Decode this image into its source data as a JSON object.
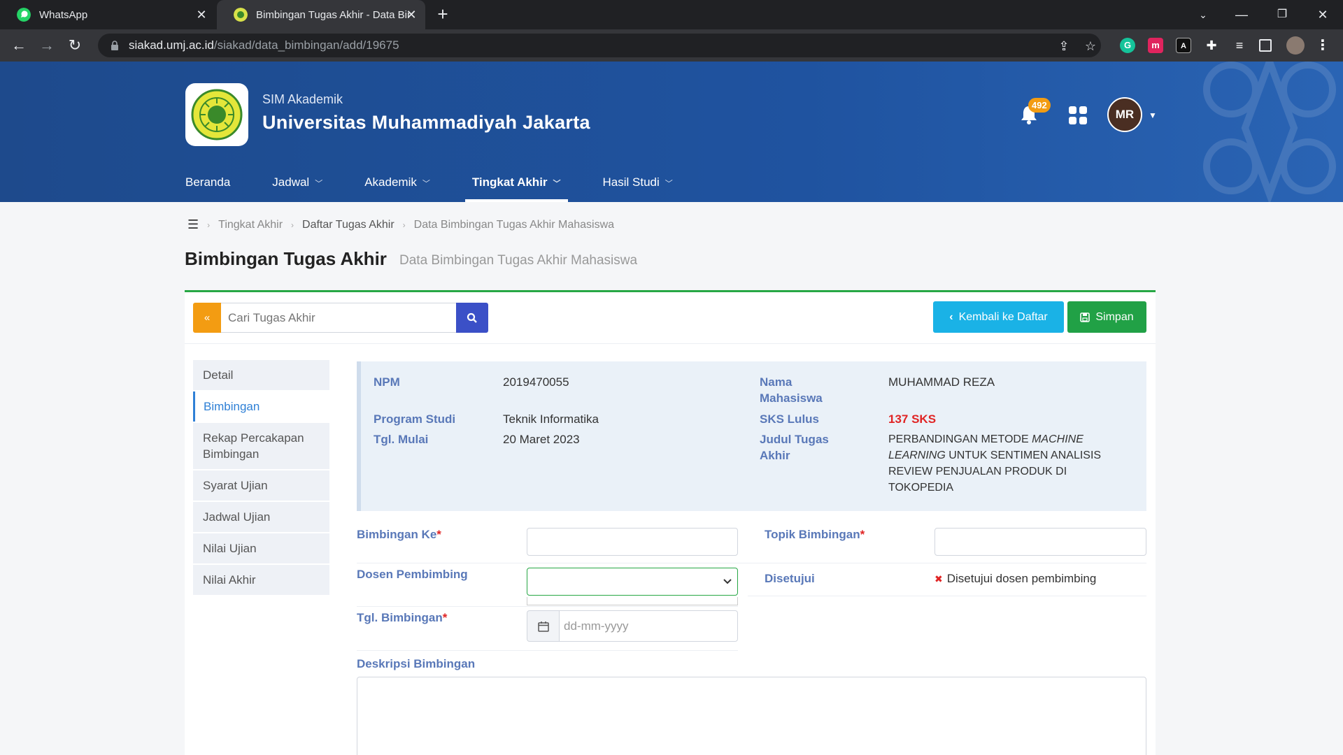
{
  "browser": {
    "tabs": [
      {
        "title": "WhatsApp",
        "close": "✕"
      },
      {
        "title": "Bimbingan Tugas Akhir - Data Bimbingan Tugas Akhir Mahasiswa",
        "close": "✕"
      }
    ],
    "new_tab": "+",
    "url_host": "siakad.umj.ac.id",
    "url_path": "/siakad/data_bimbingan/add/19675"
  },
  "header": {
    "sim_label": "SIM Akademik",
    "university": "Universitas Muhammadiyah Jakarta",
    "notification_count": "492",
    "avatar_initials": "MR",
    "menu": [
      {
        "label": "Beranda"
      },
      {
        "label": "Jadwal"
      },
      {
        "label": "Akademik"
      },
      {
        "label": "Tingkat Akhir"
      },
      {
        "label": "Hasil Studi"
      }
    ]
  },
  "breadcrumb": [
    "Tingkat Akhir",
    "Daftar Tugas Akhir",
    "Data Bimbingan Tugas Akhir Mahasiswa"
  ],
  "page": {
    "title": "Bimbingan Tugas Akhir",
    "subtitle": "Data Bimbingan Tugas Akhir Mahasiswa"
  },
  "toolbar": {
    "search_placeholder": "Cari Tugas Akhir",
    "back_label": "Kembali ke Daftar",
    "save_label": "Simpan"
  },
  "side_tabs": [
    {
      "label": "Detail"
    },
    {
      "label": "Bimbingan"
    },
    {
      "label": "Rekap Percakapan Bimbingan"
    },
    {
      "label": "Syarat Ujian"
    },
    {
      "label": "Jadwal Ujian"
    },
    {
      "label": "Nilai Ujian"
    },
    {
      "label": "Nilai Akhir"
    }
  ],
  "student": {
    "npm_label": "NPM",
    "npm": "2019470055",
    "prodi_label": "Program Studi",
    "prodi": "Teknik Informatika",
    "tgl_mulai_label": "Tgl. Mulai",
    "tgl_mulai": "20 Maret 2023",
    "nama_label_1": "Nama",
    "nama_label_2": "Mahasiswa",
    "nama": "MUHAMMAD REZA",
    "sks_label": "SKS Lulus",
    "sks": "137 SKS",
    "judul_label_1": "Judul Tugas",
    "judul_label_2": "Akhir",
    "judul_line1_pre": "PERBANDINGAN METODE",
    "judul_line1_it": "MACHINE",
    "judul_line2_it": "LEARNING",
    "judul_line2_post": "UNTUK SENTIMEN ANALISIS",
    "judul_line3": "REVIEW PENJUALAN PRODUK DI",
    "judul_line4": "TOKOPEDIA"
  },
  "form": {
    "bimbingan_ke_label": "Bimbingan Ke",
    "topik_label": "Topik Bimbingan",
    "dosen_label": "Dosen Pembimbing",
    "disetujui_label": "Disetujui",
    "disetujui_value": "Disetujui dosen pembimbing",
    "tgl_label": "Tgl. Bimbingan",
    "tgl_placeholder": "dd-mm-yyyy",
    "deskripsi_label": "Deskripsi Bimbingan",
    "required_mark": "*"
  },
  "colors": {
    "header_blue": "#1f53a0",
    "accent_green": "#21a146",
    "accent_cyan": "#1ab2e6",
    "accent_orange": "#f39c12",
    "label_blue": "#5978b8",
    "required_red": "#e02424"
  }
}
